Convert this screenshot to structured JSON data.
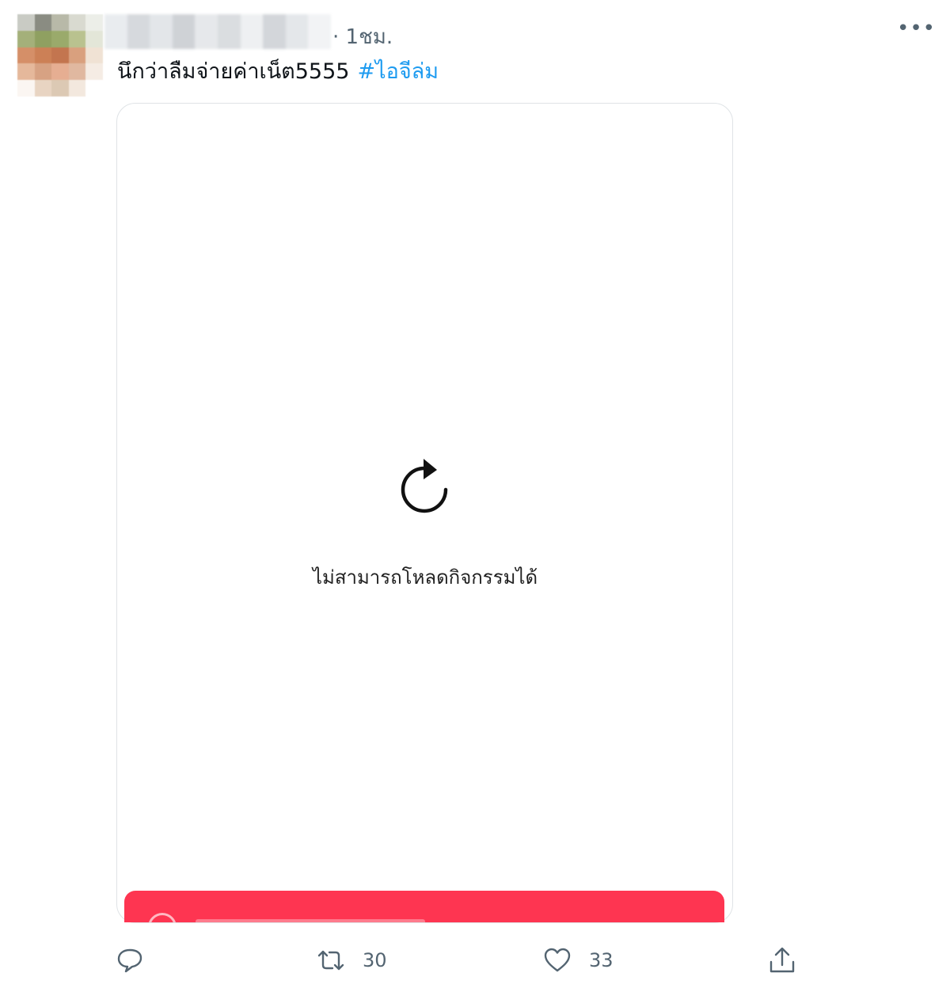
{
  "tweet": {
    "timestamp": "· 1ชม.",
    "text": "นึกว่าลืมจ่ายค่าเน็ต5555",
    "hashtag": "#ไอจีล่ม",
    "more_label": "•••"
  },
  "embed": {
    "error_message": "ไม่สามารถโหลดกิจกรรมได้",
    "bar_color": "#fe3551"
  },
  "actions": {
    "reply_count": "",
    "retweet_count": "30",
    "like_count": "33"
  },
  "colors": {
    "accent": "#1d9bf0",
    "muted": "#536471"
  }
}
